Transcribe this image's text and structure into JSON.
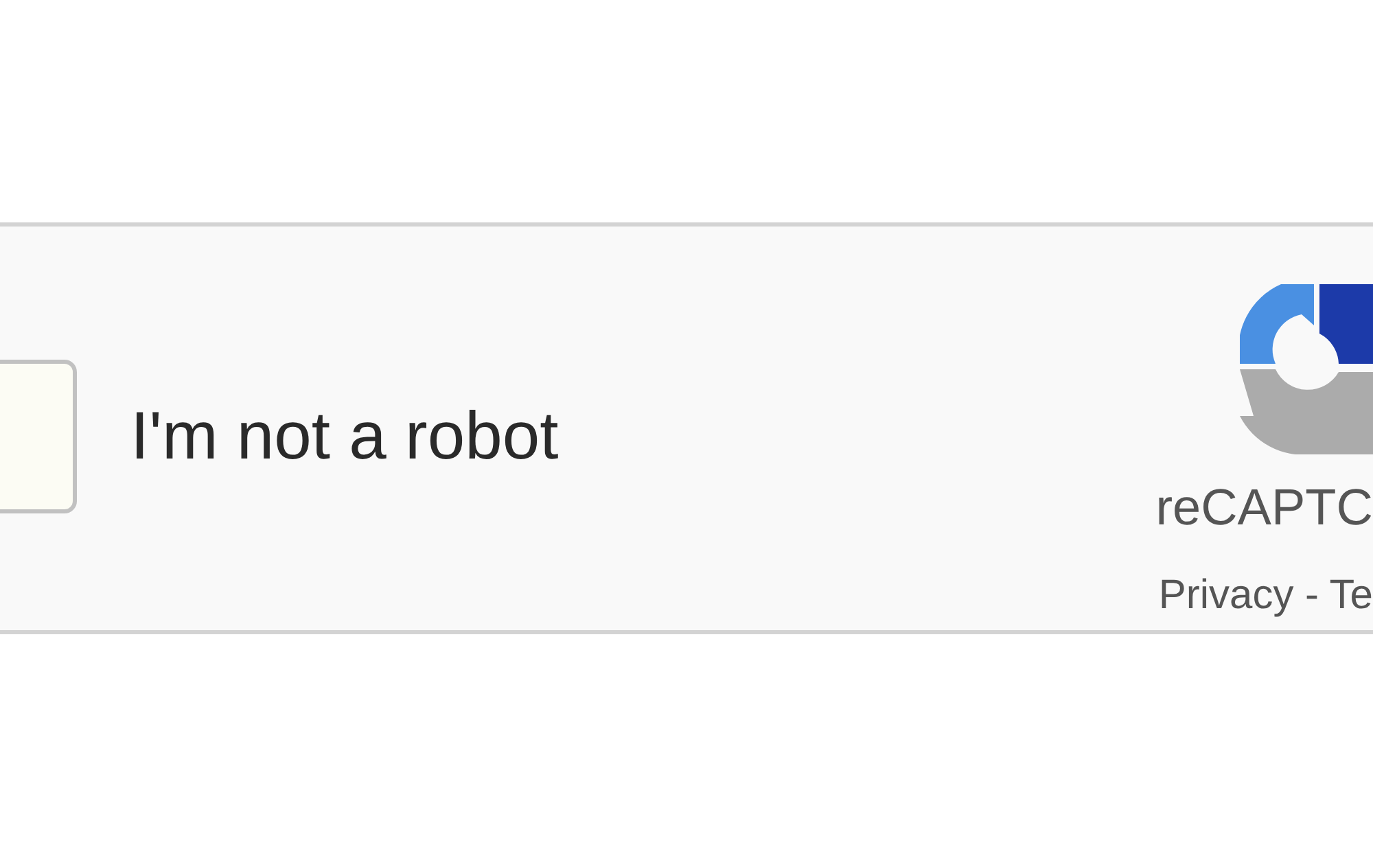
{
  "checkbox": {
    "label": "I'm not a robot",
    "checked": false
  },
  "brand": {
    "name": "reCAPTC",
    "links": "Privacy - Te"
  }
}
